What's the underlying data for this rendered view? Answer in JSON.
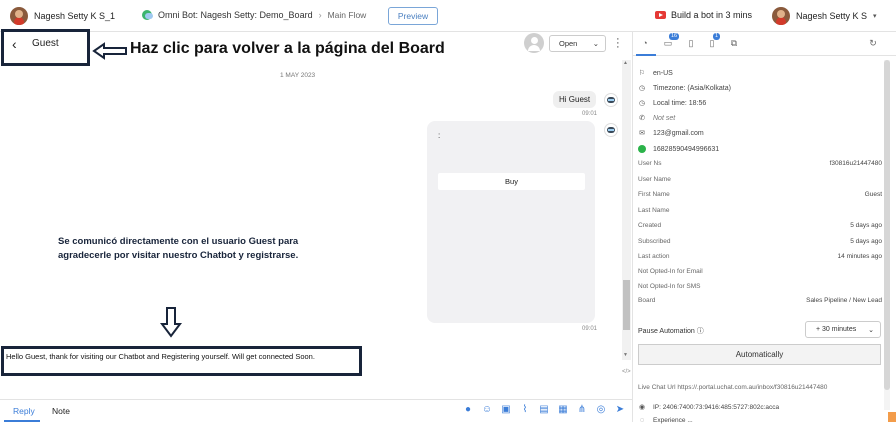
{
  "topbar": {
    "user": "Nagesh Setty K S_1",
    "bot_title": "Omni Bot: Nagesh Setty: Demo_Board",
    "flow": "Main Flow",
    "preview": "Preview",
    "youtube": "Build a bot in 3 mins",
    "account": "Nagesh Setty K S",
    "caret": "▾"
  },
  "chat": {
    "contact_name": "Guest",
    "status": "Open",
    "date": "1 MAY 2023",
    "greeting": "Hi Guest",
    "greeting_time": "09:01",
    "card_text": ":",
    "card_button": "Buy",
    "card_time": "09:01",
    "reply_text": "Hello Guest, thank for visiting our Chatbot and Registering yourself. Will get connected Soon.",
    "tab_reply": "Reply",
    "tab_note": "Note",
    "code_toggle": "</>"
  },
  "annotations": {
    "top_callout": "Haz clic para volver a la página del Board",
    "mid_callout": "Se comunicó directamente con el usuario Guest para agradecerle por visitar nuestro Chatbot y registrarse."
  },
  "profile": {
    "tabs": [
      {
        "icon": "person-icon",
        "badge": ""
      },
      {
        "icon": "inbox-icon",
        "badge": "16"
      },
      {
        "icon": "bookmark-icon",
        "badge": ""
      },
      {
        "icon": "clipboard-icon",
        "badge": "1"
      },
      {
        "icon": "copy-icon",
        "badge": ""
      }
    ],
    "locale": "en-US",
    "timezone": "Timezone: (Asia/Kolkata)",
    "local_time": "Local time: 18:56",
    "phone": "Not set",
    "email": "123@gmail.com",
    "whatsapp": "16828590494996631",
    "fields": [
      {
        "label": "User Ns",
        "value": "f30816u21447480"
      },
      {
        "label": "User Name",
        "value": ""
      },
      {
        "label": "First Name",
        "value": "Guest"
      },
      {
        "label": "Last Name",
        "value": ""
      },
      {
        "label": "Created",
        "value": "5 days ago"
      },
      {
        "label": "Subscribed",
        "value": "5 days ago"
      },
      {
        "label": "Last action",
        "value": "14 minutes ago"
      },
      {
        "label": "Not Opted-In for Email",
        "value": ""
      },
      {
        "label": "Not Opted-In for SMS",
        "value": ""
      },
      {
        "label": "Board",
        "value": "Sales Pipeline / New Lead"
      }
    ],
    "pause_label": "Pause Automation ⓘ",
    "pause_value": "+ 30 minutes",
    "auto_button": "Automatically",
    "live_chat": "Live Chat Url  https://.portal.uchat.com.au/inbox/f30816u21447480",
    "ip": "IP: 2406:7400:73:9416:485:5727:802c:acca",
    "partial": "Experience  ..."
  }
}
